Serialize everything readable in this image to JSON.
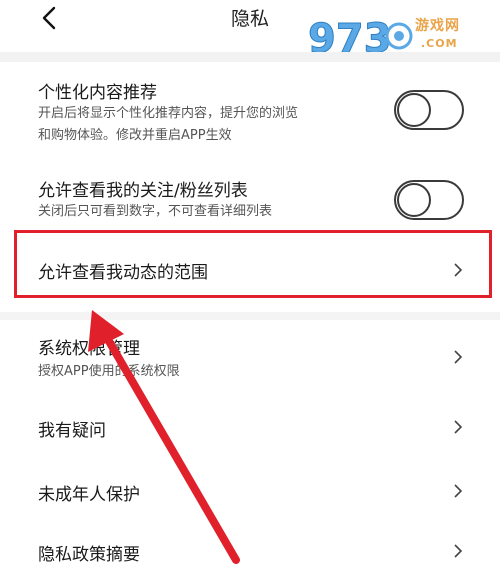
{
  "header": {
    "title": "隐私",
    "back_icon": "chevron-left-icon"
  },
  "watermark": {
    "digits": "973",
    "site": "游戏网",
    "domain": ".COM"
  },
  "settings": [
    {
      "title": "个性化内容推荐",
      "desc_line1": "开启后将显示个性化推荐内容，提升您的浏览",
      "desc_line2": "和购物体验。修改并重启APP生效",
      "control": "toggle",
      "toggle_on": false
    },
    {
      "title": "允许查看我的关注/粉丝列表",
      "desc_line1": "关闭后只可看到数字，不可查看详细列表",
      "control": "toggle",
      "toggle_on": false
    },
    {
      "title": "允许查看我动态的范围",
      "control": "chevron",
      "highlighted": true
    },
    {
      "title": "系统权限管理",
      "desc_line1": "授权APP使用的系统权限",
      "control": "chevron"
    },
    {
      "title": "我有疑问",
      "control": "chevron"
    },
    {
      "title": "未成年人保护",
      "control": "chevron"
    },
    {
      "title": "隐私政策摘要",
      "control": "chevron"
    }
  ],
  "colors": {
    "highlight": "#e0202a",
    "arrow": "#e0202a",
    "watermark_blue": "#5aa9e6",
    "watermark_orange": "#e9a44a"
  }
}
